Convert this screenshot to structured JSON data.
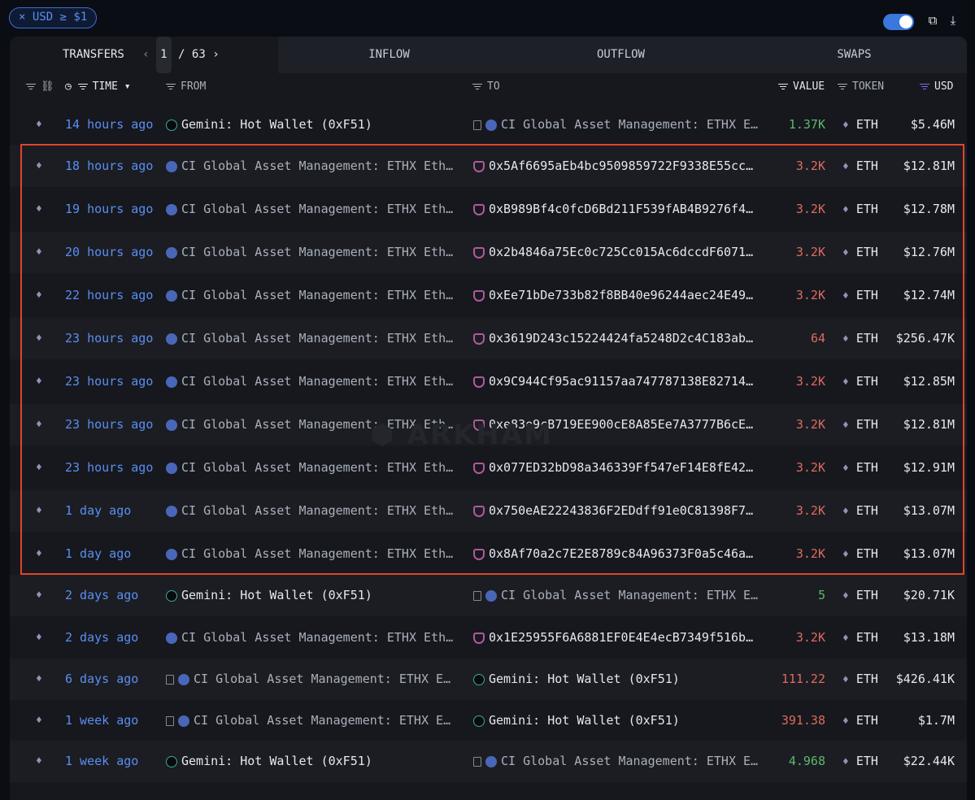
{
  "filter_chip": "× USD ≥ $1",
  "tabs": {
    "transfers": "TRANSFERS",
    "page_current": "1",
    "page_total": "/ 63",
    "inflow": "INFLOW",
    "outflow": "OUTFLOW",
    "swaps": "SWAPS"
  },
  "columns": {
    "time": "TIME",
    "from": "FROM",
    "to": "TO",
    "value": "VALUE",
    "token": "TOKEN",
    "usd": "USD"
  },
  "watermark": "ARKHAM",
  "rows": [
    {
      "time": "14 hours ago",
      "from": {
        "icon": "gemini",
        "name": "Gemini: Hot Wallet (0xF51)"
      },
      "to": {
        "icon": "ci",
        "doc": true,
        "name": "CI Global Asset Management: ETHX E…"
      },
      "value": "1.37K",
      "dir": "in",
      "token": "ETH",
      "usd": "$5.46M"
    },
    {
      "time": "18 hours ago",
      "from": {
        "icon": "ci",
        "name": "CI Global Asset Management: ETHX Eth…"
      },
      "to": {
        "icon": "shield",
        "name": "0x5Af6695aEb4bc9509859722F9338E55cc…"
      },
      "value": "3.2K",
      "dir": "out",
      "token": "ETH",
      "usd": "$12.81M"
    },
    {
      "time": "19 hours ago",
      "from": {
        "icon": "ci",
        "name": "CI Global Asset Management: ETHX Eth…"
      },
      "to": {
        "icon": "shield",
        "name": "0xB989Bf4c0fcD6Bd211F539fAB4B9276f4…"
      },
      "value": "3.2K",
      "dir": "out",
      "token": "ETH",
      "usd": "$12.78M"
    },
    {
      "time": "20 hours ago",
      "from": {
        "icon": "ci",
        "name": "CI Global Asset Management: ETHX Eth…"
      },
      "to": {
        "icon": "shield",
        "name": "0x2b4846a75Ec0c725Cc015Ac6dccdF6071…"
      },
      "value": "3.2K",
      "dir": "out",
      "token": "ETH",
      "usd": "$12.76M"
    },
    {
      "time": "22 hours ago",
      "from": {
        "icon": "ci",
        "name": "CI Global Asset Management: ETHX Eth…"
      },
      "to": {
        "icon": "shield",
        "name": "0xEe71bDe733b82f8BB40e96244aec24E49…"
      },
      "value": "3.2K",
      "dir": "out",
      "token": "ETH",
      "usd": "$12.74M"
    },
    {
      "time": "23 hours ago",
      "from": {
        "icon": "ci",
        "name": "CI Global Asset Management: ETHX Eth…"
      },
      "to": {
        "icon": "shield",
        "name": "0x3619D243c15224424fa5248D2c4C183ab…"
      },
      "value": "64",
      "dir": "out",
      "token": "ETH",
      "usd": "$256.47K"
    },
    {
      "time": "23 hours ago",
      "from": {
        "icon": "ci",
        "name": "CI Global Asset Management: ETHX Eth…"
      },
      "to": {
        "icon": "shield",
        "name": "0x9C944Cf95ac91157aa747787138E82714…"
      },
      "value": "3.2K",
      "dir": "out",
      "token": "ETH",
      "usd": "$12.85M"
    },
    {
      "time": "23 hours ago",
      "from": {
        "icon": "ci",
        "name": "CI Global Asset Management: ETHX Eth…"
      },
      "to": {
        "icon": "shield",
        "name": "0xe83e9cB719EE900cE8A85Ee7A3777B6cE…"
      },
      "value": "3.2K",
      "dir": "out",
      "token": "ETH",
      "usd": "$12.81M"
    },
    {
      "time": "23 hours ago",
      "from": {
        "icon": "ci",
        "name": "CI Global Asset Management: ETHX Eth…"
      },
      "to": {
        "icon": "shield",
        "name": "0x077ED32bD98a346339Ff547eF14E8fE42…"
      },
      "value": "3.2K",
      "dir": "out",
      "token": "ETH",
      "usd": "$12.91M"
    },
    {
      "time": "1 day ago",
      "from": {
        "icon": "ci",
        "name": "CI Global Asset Management: ETHX Eth…"
      },
      "to": {
        "icon": "shield",
        "name": "0x750eAE22243836F2EDdff91e0C81398F7…"
      },
      "value": "3.2K",
      "dir": "out",
      "token": "ETH",
      "usd": "$13.07M"
    },
    {
      "time": "1 day ago",
      "from": {
        "icon": "ci",
        "name": "CI Global Asset Management: ETHX Eth…"
      },
      "to": {
        "icon": "shield",
        "name": "0x8Af70a2c7E2E8789c84A96373F0a5c46a…"
      },
      "value": "3.2K",
      "dir": "out",
      "token": "ETH",
      "usd": "$13.07M"
    },
    {
      "time": "2 days ago",
      "from": {
        "icon": "gemini",
        "name": "Gemini: Hot Wallet (0xF51)"
      },
      "to": {
        "icon": "ci",
        "doc": true,
        "name": "CI Global Asset Management: ETHX E…"
      },
      "value": "5",
      "dir": "in",
      "token": "ETH",
      "usd": "$20.71K"
    },
    {
      "time": "2 days ago",
      "from": {
        "icon": "ci",
        "name": "CI Global Asset Management: ETHX Eth…"
      },
      "to": {
        "icon": "shield",
        "name": "0x1E25955F6A6881EF0E4E4ecB7349f516b…"
      },
      "value": "3.2K",
      "dir": "out",
      "token": "ETH",
      "usd": "$13.18M"
    },
    {
      "time": "6 days ago",
      "from": {
        "icon": "ci",
        "doc": true,
        "name": "CI Global Asset Management: ETHX E…"
      },
      "to": {
        "icon": "gemini",
        "name": "Gemini: Hot Wallet (0xF51)"
      },
      "value": "111.22",
      "dir": "out",
      "token": "ETH",
      "usd": "$426.41K"
    },
    {
      "time": "1 week ago",
      "from": {
        "icon": "ci",
        "doc": true,
        "name": "CI Global Asset Management: ETHX E…"
      },
      "to": {
        "icon": "gemini",
        "name": "Gemini: Hot Wallet (0xF51)"
      },
      "value": "391.38",
      "dir": "out",
      "token": "ETH",
      "usd": "$1.7M"
    },
    {
      "time": "1 week ago",
      "from": {
        "icon": "gemini",
        "name": "Gemini: Hot Wallet (0xF51)"
      },
      "to": {
        "icon": "ci",
        "doc": true,
        "name": "CI Global Asset Management: ETHX E…"
      },
      "value": "4.968",
      "dir": "in",
      "token": "ETH",
      "usd": "$22.44K"
    }
  ]
}
